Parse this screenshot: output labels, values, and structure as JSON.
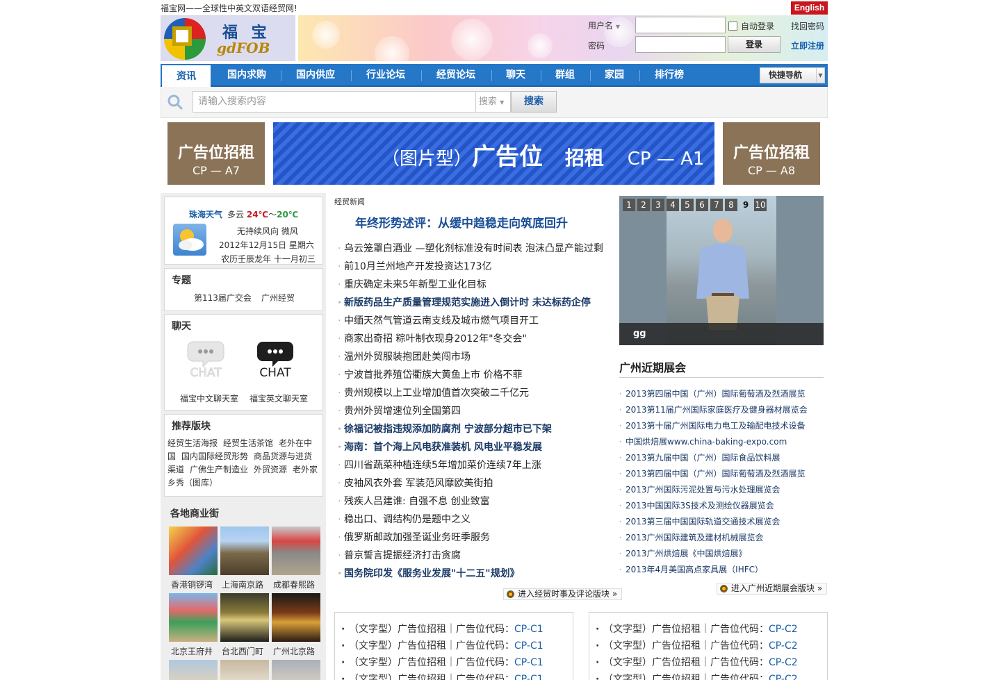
{
  "header": {
    "tagline": "福宝网——全球性中英文双语经贸网!",
    "english_button": "English",
    "logo_cn": "福 宝",
    "logo_en": "gdFOB"
  },
  "login": {
    "username_label": "用户名",
    "password_label": "密码",
    "auto_login": "自动登录",
    "forgot": "找回密码",
    "login_button": "登录",
    "register": "立即注册"
  },
  "nav": {
    "items": [
      "资讯",
      "国内求购",
      "国内供应",
      "行业论坛",
      "经贸论坛",
      "聊天",
      "群组",
      "家园",
      "排行榜"
    ],
    "quick": "快捷导航"
  },
  "search": {
    "placeholder": "请输入搜索内容",
    "select": "搜索",
    "button": "搜索"
  },
  "ads": {
    "left_t1": "广告位招租",
    "left_t2": "CP — A7",
    "right_t1": "广告位招租",
    "right_t2": "CP — A8",
    "main_a": "（图片型）",
    "main_b": "广告位",
    "main_c": "招租",
    "main_d": "CP — A1"
  },
  "weather": {
    "city": "珠海天气",
    "cond": "多云",
    "low": "24℃",
    "sep": "～",
    "high": "20℃",
    "wind": "无持续风向 微风",
    "date": "2012年12月15日 星期六",
    "lunar": "农历壬辰龙年 十一月初三"
  },
  "topics": {
    "title": "专题",
    "links": [
      "第113届广交会",
      "广州经贸"
    ]
  },
  "chat": {
    "title": "聊天",
    "cn_label": "福宝中文聊天室",
    "en_label": "福宝英文聊天室",
    "icon_text": "CHAT"
  },
  "recommend": {
    "title": "推荐版块",
    "items": [
      "经贸生活海报",
      "经贸生活茶馆",
      "老外在中国",
      "国内国际经贸形势",
      "商品货源与进货渠道",
      "广佛生产制造业",
      "外贸资源",
      "老外家乡秀（图库）"
    ]
  },
  "streets": {
    "title": "各地商业街",
    "items": [
      "香港铜锣湾",
      "上海南京路",
      "成都春熙路",
      "北京王府井",
      "台北西门町",
      "广州北京路"
    ]
  },
  "news": {
    "section": "经贸新闻",
    "headline": "年终形势述评：从缓中趋稳走向筑底回升",
    "items": [
      {
        "text": "乌云笼罩白酒业 —塑化剂标准没有时间表 泡沫凸显产能过剩",
        "bold": false
      },
      {
        "text": "前10月兰州地产开发投资达173亿",
        "bold": false
      },
      {
        "text": "重庆确定未来5年新型工业化目标",
        "bold": false
      },
      {
        "text": "新版药品生产质量管理规范实施进入倒计时 未达标药企停",
        "bold": true
      },
      {
        "text": "中缅天然气管道云南支线及城市燃气项目开工",
        "bold": false
      },
      {
        "text": "商家出奇招 粽叶制衣现身2012年\"冬交会\"",
        "bold": false
      },
      {
        "text": "温州外贸服装抱团赴美闯市场",
        "bold": false
      },
      {
        "text": "宁波首批养殖岱衢族大黄鱼上市 价格不菲",
        "bold": false
      },
      {
        "text": "贵州规模以上工业增加值首次突破二千亿元",
        "bold": false
      },
      {
        "text": "贵州外贸增速位列全国第四",
        "bold": false
      },
      {
        "text": "徐福记被指违规添加防腐剂 宁波部分超市已下架",
        "bold": true
      },
      {
        "text": "海南：首个海上风电获准装机 风电业平稳发展",
        "bold": true
      },
      {
        "text": "四川省蔬菜种植连续5年增加菜价连续7年上涨",
        "bold": false
      },
      {
        "text": "皮袖风衣外套 军装范风靡欧美街拍",
        "bold": false
      },
      {
        "text": "残疾人吕建谁: 自强不息 创业致富",
        "bold": false
      },
      {
        "text": "稳出口、调结构仍是题中之义",
        "bold": false
      },
      {
        "text": "俄罗斯邮政加强圣诞业务旺季服务",
        "bold": false
      },
      {
        "text": "普京誓言提振经济打击贪腐",
        "bold": false
      },
      {
        "text": "国务院印发《服务业发展\"十二五\"规划》",
        "bold": true
      }
    ],
    "more": "进入经贸时事及评论版块 »"
  },
  "slideshow": {
    "pages": [
      "1",
      "2",
      "3",
      "4",
      "5",
      "6",
      "7",
      "8",
      "9",
      "10"
    ],
    "active": "9",
    "caption": "gg"
  },
  "expo": {
    "title": "广州近期展会",
    "items": [
      "2013第四届中国（广州）国际葡萄酒及烈酒展览",
      "2013第11届广州国际家庭医疗及健身器材展览会",
      "2013第十届广州国际电力电工及输配电技术设备",
      "中国烘焙展www.china-baking-expo.com",
      "2013第九届中国（广州）国际食品饮料展",
      "2013第四届中国（广州）国际葡萄酒及烈酒展览",
      "2013广州国际污泥处置与污水处理展览会",
      "2013中国国际3S技术及测绘仪器展览会",
      "2013第三届中国国际轨道交通技术展览会",
      "2013广州国际建筑及建材机械展览会",
      "2013广州烘焙展《中国烘焙展》",
      "2013年4月美国高点家具展（IHFC）"
    ],
    "more": "进入广州近期展会版块 »"
  },
  "text_ads": {
    "label": "（文字型）广告位招租｜广告位代码：",
    "left_code": "CP-C1",
    "right_code": "CP-C2"
  },
  "colors": {
    "nav_blue": "#2577c8",
    "english_red": "#c8161d",
    "ad_brown": "#8b7358",
    "link_blue": "#1a4e96"
  }
}
